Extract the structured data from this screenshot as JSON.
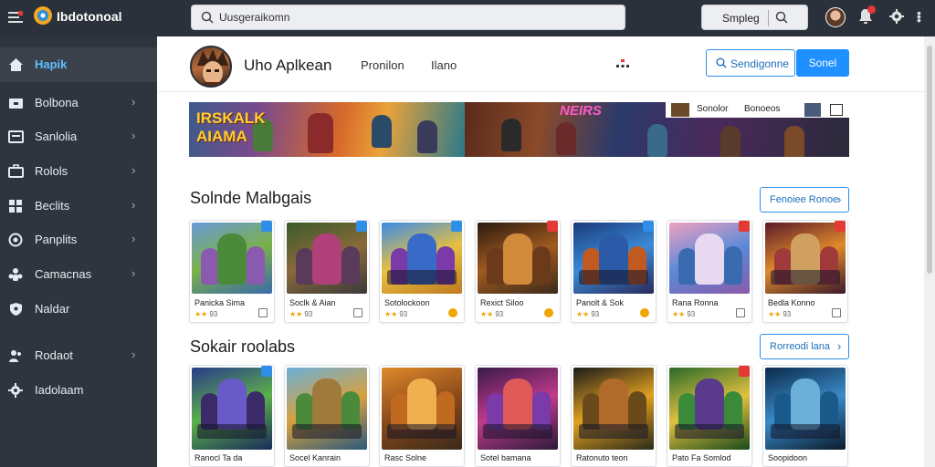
{
  "app": {
    "name": "Ibdotonoal"
  },
  "search": {
    "placeholder": "Uusgeraikomn"
  },
  "topbar": {
    "simplex_label": "Smpleg"
  },
  "sidebar": {
    "items": [
      {
        "label": "Hapik",
        "icon": "home-icon",
        "active": true
      },
      {
        "label": "Bolbona",
        "icon": "folder-icon"
      },
      {
        "label": "Sanlolia",
        "icon": "inbox-icon"
      },
      {
        "label": "Rolols",
        "icon": "briefcase-icon"
      },
      {
        "label": "Beclits",
        "icon": "grid-icon"
      },
      {
        "label": "Panplits",
        "icon": "target-icon"
      },
      {
        "label": "Camacnas",
        "icon": "people-icon"
      },
      {
        "label": "Naldar",
        "icon": "shield-icon"
      },
      {
        "label": "Rodaot",
        "icon": "users-icon"
      },
      {
        "label": "Iadolaam",
        "icon": "gear-icon"
      }
    ]
  },
  "profile": {
    "name": "Uho Aplkean",
    "tab1": "Pronilon",
    "tab2": "Ilano",
    "outline_button": "Sendigonne",
    "primary_button": "Sonel"
  },
  "banner": {
    "left_title_line1": "IRSKALK",
    "left_title_line2": "AIAMA",
    "right_title": "NEIRS",
    "strip_label1": "Sonolor",
    "strip_label2": "Bonoeos"
  },
  "sections": [
    {
      "title": "Solnde Malbgais",
      "see_more": "Fenoiee Ronoe",
      "cards": [
        {
          "title": "Panicka Sima",
          "rating": "93"
        },
        {
          "title": "Soclk & Aian",
          "rating": "93"
        },
        {
          "title": "Sotolockoon",
          "rating": "93"
        },
        {
          "title": "Rexict Siloo",
          "rating": "93"
        },
        {
          "title": "Panolt & Sok",
          "rating": "93"
        },
        {
          "title": "Rana Ronna",
          "rating": "93"
        },
        {
          "title": "Bedla Konno",
          "rating": "93"
        }
      ]
    },
    {
      "title": "Sokair roolabs",
      "see_more": "Rorreodi lana",
      "cards": [
        {
          "title": "Ranocl Ta da"
        },
        {
          "title": "Socel Kanrain"
        },
        {
          "title": "Rasc Solne"
        },
        {
          "title": "Sotel bamana"
        },
        {
          "title": "Ratonuto teon"
        },
        {
          "title": "Pato Fa Somlod"
        },
        {
          "title": "Soopidoon"
        }
      ]
    }
  ],
  "colors": {
    "accent": "#1e90ff",
    "sidebar_bg": "#2f353e",
    "topbar_bg": "#2b313a",
    "active_label": "#5ec0ff"
  }
}
